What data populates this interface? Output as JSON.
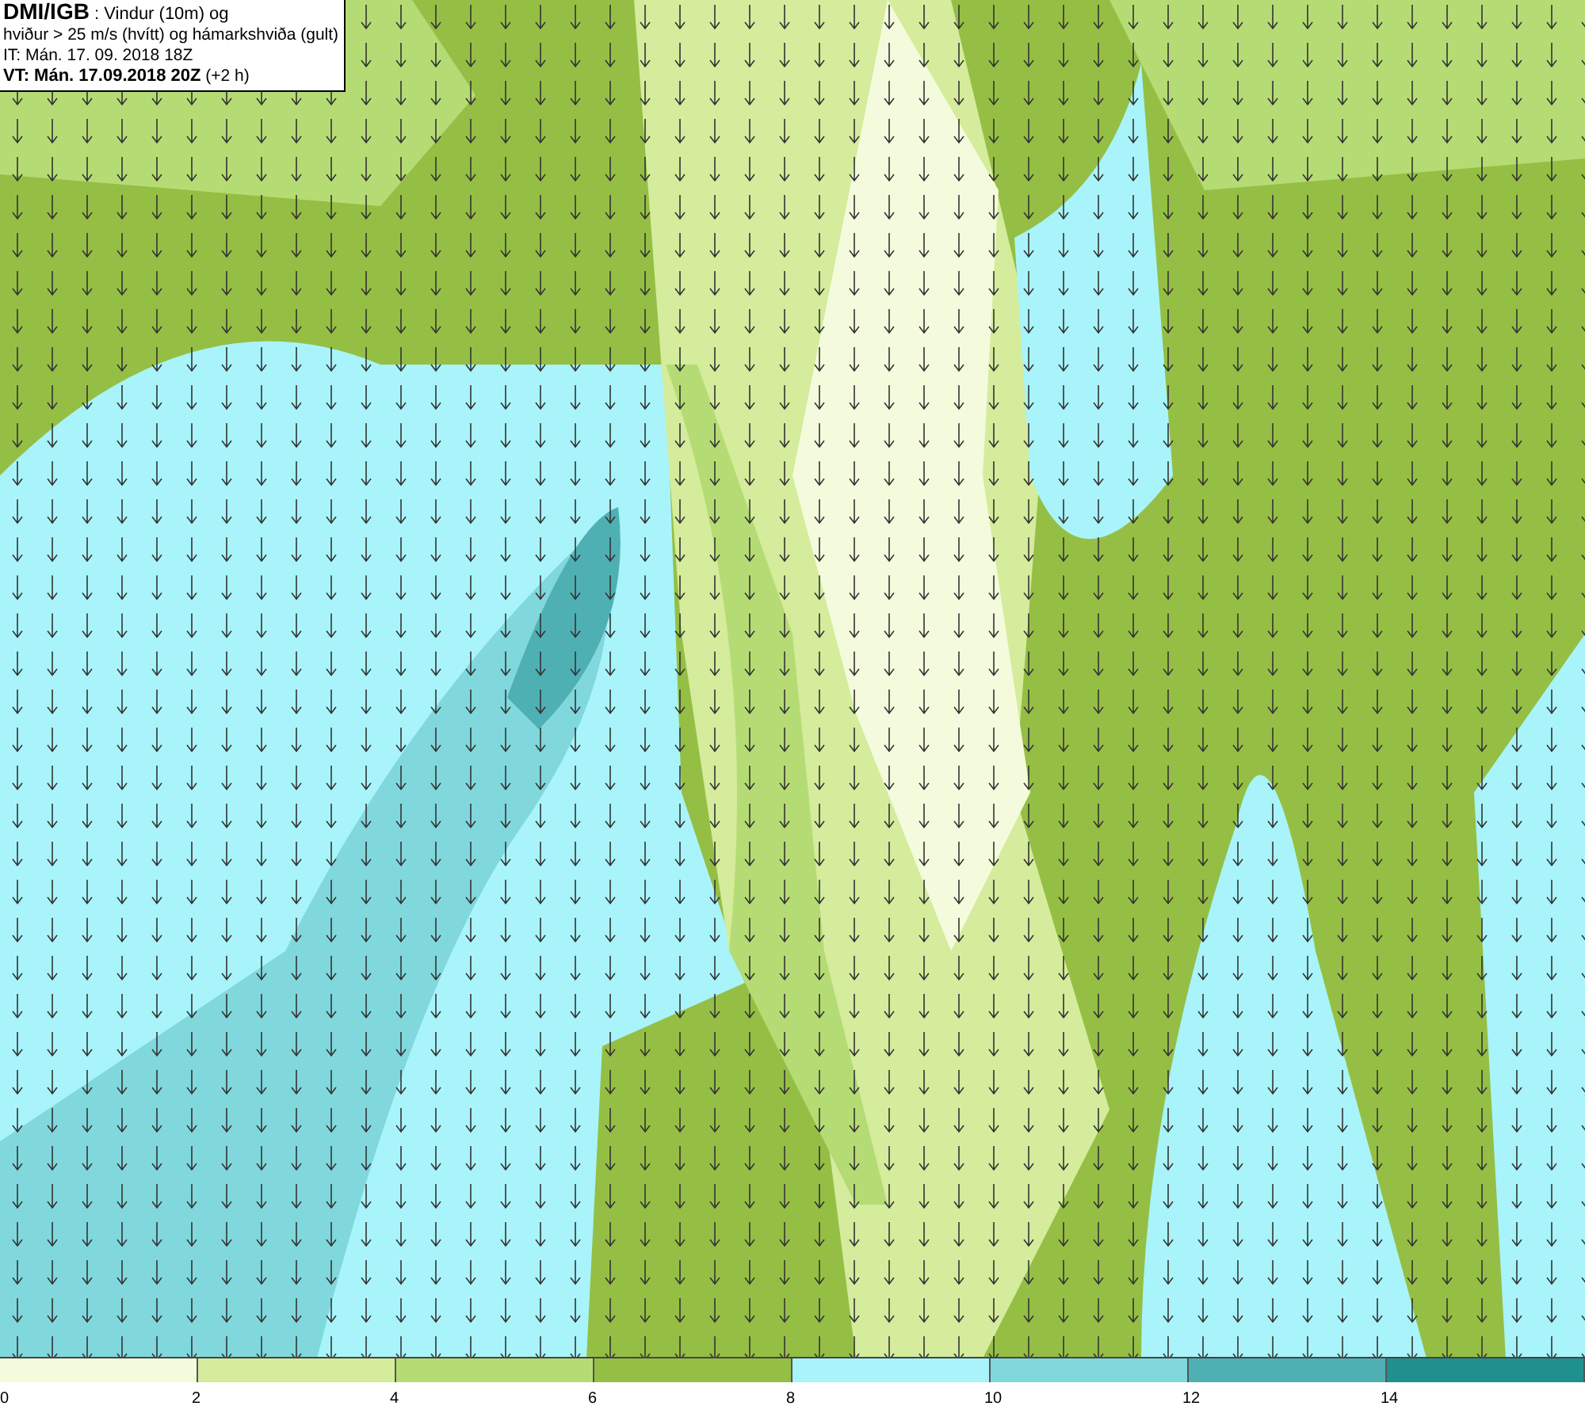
{
  "header": {
    "lines": [
      "**DMI/IGB** : Vindur (10m) og",
      "hviður > 25 m/s (hvítt) og hámarkshviða (gult)",
      "IT: Mán. 17. 09. 2018 18Z",
      "**VT: Mán. 17.09.2018 20Z** (+2 h)"
    ]
  },
  "legend": [
    {
      "label": "0",
      "color": "#f4fbdc"
    },
    {
      "label": "2",
      "color": "#d4ec9c"
    },
    {
      "label": "4",
      "color": "#b5dc74"
    },
    {
      "label": "6",
      "color": "#95bf44"
    },
    {
      "label": "8",
      "color": "#a8f4fa"
    },
    {
      "label": "10",
      "color": "#80d8dc"
    },
    {
      "label": "12",
      "color": "#4fb0b4"
    },
    {
      "label": "14",
      "color": "#20908f"
    }
  ]
}
